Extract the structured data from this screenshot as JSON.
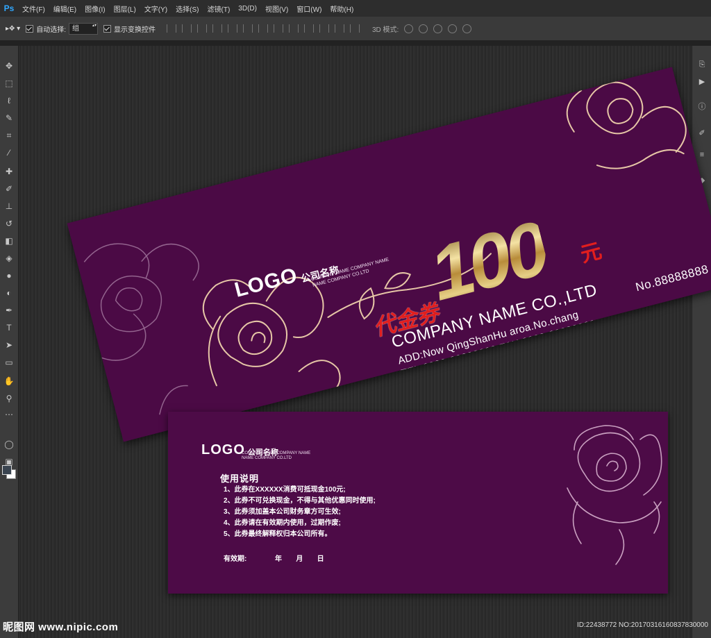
{
  "app": {
    "logo": "Ps"
  },
  "menu": [
    "文件(F)",
    "编辑(E)",
    "图像(I)",
    "图层(L)",
    "文字(Y)",
    "选择(S)",
    "滤镜(T)",
    "3D(D)",
    "视图(V)",
    "窗口(W)",
    "帮助(H)"
  ],
  "options": {
    "auto_select_label": "自动选择:",
    "auto_select_value": "组",
    "show_transform_label": "显示变换控件",
    "mode3d_label": "3D 模式:"
  },
  "front": {
    "logo": "LOGO",
    "logo_cn": "公司名称",
    "logo_sub1": "COMPANY NAME COMPANY NAME",
    "logo_sub2": "NAME COMPANY CO.LTD",
    "label": "代金券",
    "amount": "100",
    "unit": "元",
    "company": "COMPANY NAME CO.,LTD",
    "address": "ADD:Now QingShanHu aroa.No.chang",
    "tel_fax": "TEL:8888-88888888   FAX:8888-88888888",
    "serial": "No.88888888"
  },
  "back": {
    "logo": "LOGO",
    "logo_cn": "公司名称",
    "logo_sub1": "COMPANY NAME COMPANY NAME",
    "logo_sub2": "NAME COMPANY CO.LTD",
    "title": "使用说明",
    "rules": [
      "1、此券在XXXXXX消费可抵现金100元;",
      "2、此券不可兑换现金，不得与其他优惠同时使用;",
      "3、此券须加盖本公司财务章方可生效;",
      "4、此券请在有效期内使用，过期作废;",
      "5、此券最终解释权归本公司所有。"
    ],
    "validity": "有效期:      年   月   日"
  },
  "watermark": {
    "site": "昵图网 www.nipic.com",
    "id": "ID:22438772 NO:20170316160837830000"
  },
  "colors": {
    "voucher_bg": "#4b0a45",
    "gold": "#d8bf75",
    "red": "#e11e1e"
  }
}
